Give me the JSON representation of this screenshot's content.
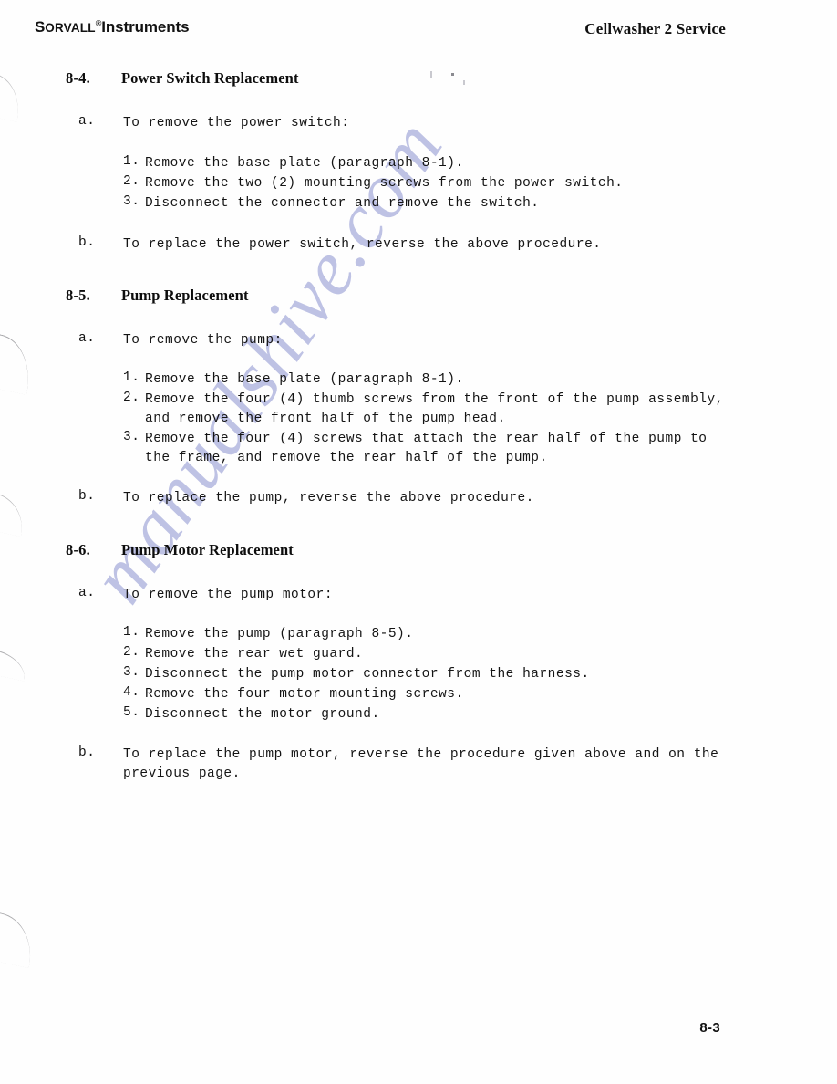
{
  "document": {
    "header_left_lead": "S",
    "header_left_smallcaps": "ORVALL",
    "header_left_registered": "®",
    "header_left_suffix": "Instruments",
    "header_right": "Cellwasher 2 Service",
    "page_number": "8-3",
    "watermark": "manualshive.com",
    "watermark_color": "#b9bde2"
  },
  "sections": [
    {
      "number": "8-4.",
      "title": "Power Switch Replacement",
      "intro_label": "a.",
      "intro_text": "To remove the power switch:",
      "steps": [
        {
          "num": "1.",
          "text": "Remove the base plate (paragraph 8-1)."
        },
        {
          "num": "2.",
          "text": "Remove the two (2) mounting screws from the power switch."
        },
        {
          "num": "3.",
          "text": "Disconnect the connector and remove the switch."
        }
      ],
      "closing_label": "b.",
      "closing_text": "To replace the power switch, reverse the above procedure."
    },
    {
      "number": "8-5.",
      "title": "Pump Replacement",
      "intro_label": "a.",
      "intro_text": "To remove the pump:",
      "steps": [
        {
          "num": "1.",
          "text": "Remove the base plate (paragraph 8-1)."
        },
        {
          "num": "2.",
          "text": "Remove the four (4) thumb screws from the front of the pump assembly, and remove the front half of the pump head."
        },
        {
          "num": "3.",
          "text": "Remove the four (4) screws that attach the rear half of the pump to the frame, and remove the rear half of the pump."
        }
      ],
      "closing_label": "b.",
      "closing_text": "To replace the pump, reverse the above procedure."
    },
    {
      "number": "8-6.",
      "title": "Pump Motor Replacement",
      "intro_label": "a.",
      "intro_text": "To remove the pump motor:",
      "steps": [
        {
          "num": "1.",
          "text": "Remove the pump (paragraph 8-5)."
        },
        {
          "num": "2.",
          "text": "Remove the rear wet guard."
        },
        {
          "num": "3.",
          "text": "Disconnect the pump motor connector from the harness."
        },
        {
          "num": "4.",
          "text": "Remove the four motor mounting screws."
        },
        {
          "num": "5.",
          "text": "Disconnect the motor ground."
        }
      ],
      "closing_label": "b.",
      "closing_text": "To replace the pump motor, reverse the procedure given above and on the previous page."
    }
  ]
}
